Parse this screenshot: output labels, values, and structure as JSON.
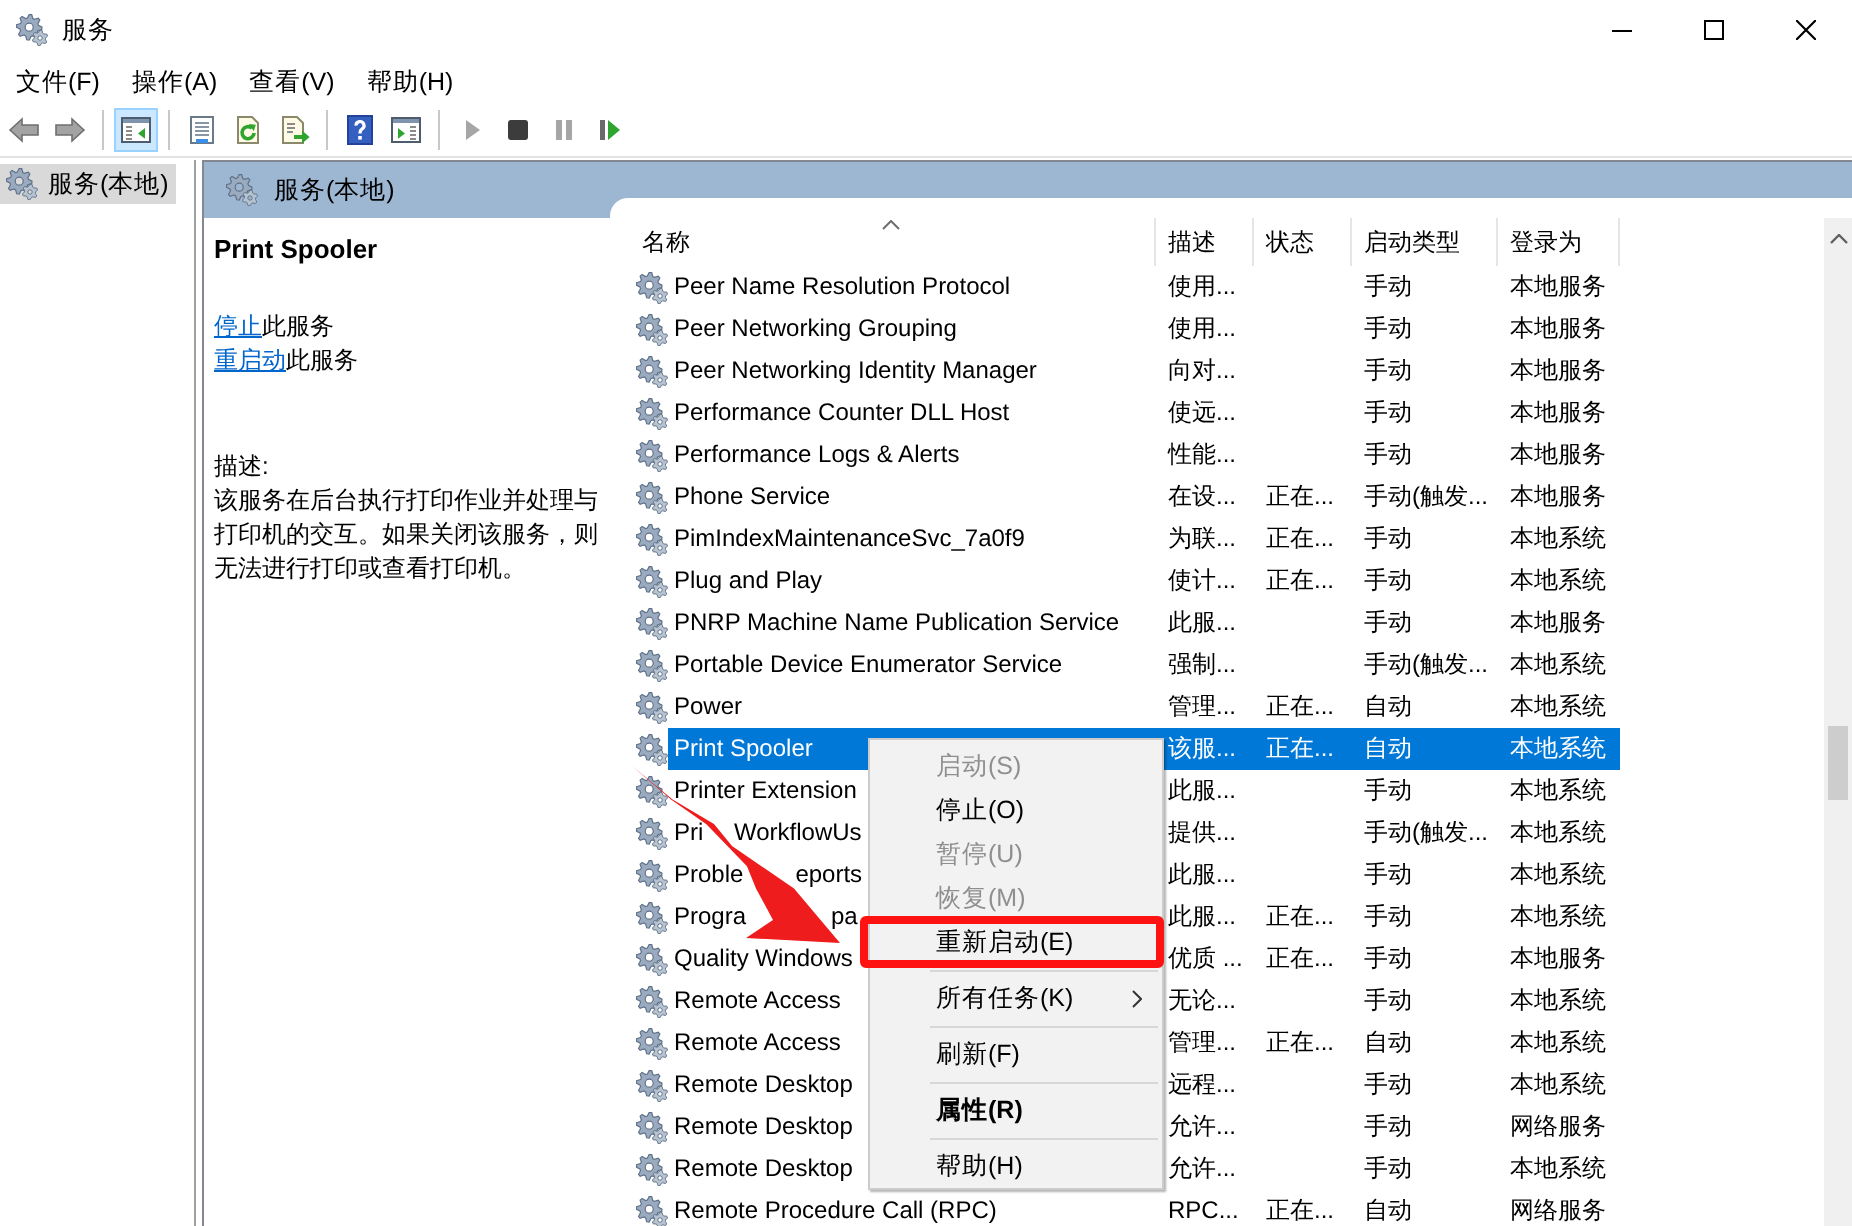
{
  "window": {
    "title": "服务"
  },
  "menu_bar": [
    "文件(F)",
    "操作(A)",
    "查看(V)",
    "帮助(H)"
  ],
  "toolbar": [
    [
      {
        "kind": "back",
        "on": false,
        "disabled": false
      },
      {
        "kind": "forward",
        "on": false,
        "disabled": false
      }
    ],
    [
      {
        "kind": "console-tree",
        "on": true,
        "disabled": false
      }
    ],
    [
      {
        "kind": "properties",
        "on": false,
        "disabled": false
      },
      {
        "kind": "refresh",
        "on": false,
        "disabled": false
      },
      {
        "kind": "export",
        "on": false,
        "disabled": false
      }
    ],
    [
      {
        "kind": "help",
        "on": false,
        "disabled": false
      },
      {
        "kind": "action-pane",
        "on": false,
        "disabled": false
      }
    ],
    [
      {
        "kind": "start",
        "on": false,
        "disabled": true
      },
      {
        "kind": "stop",
        "on": false,
        "disabled": false
      },
      {
        "kind": "pause",
        "on": false,
        "disabled": true
      },
      {
        "kind": "restart",
        "on": false,
        "disabled": false
      }
    ]
  ],
  "tree": {
    "items": [
      {
        "label": "服务(本地)",
        "selected": true
      }
    ]
  },
  "panel": {
    "title": "服务(本地)"
  },
  "details": {
    "service_name": "Print Spooler",
    "actions": [
      {
        "link": "停止",
        "text": "此服务"
      },
      {
        "link": "重启动",
        "text": "此服务"
      }
    ],
    "description_label": "描述:",
    "description": "该服务在后台执行打印作业并处理与打印机的交互。如果关闭该服务，则无法进行打印或查看打印机。"
  },
  "table": {
    "columns": [
      {
        "label": "名称",
        "sorted": true
      },
      {
        "label": "描述",
        "sorted": false
      },
      {
        "label": "状态",
        "sorted": false
      },
      {
        "label": "启动类型",
        "sorted": false
      },
      {
        "label": "登录为",
        "sorted": false
      }
    ],
    "rows": [
      {
        "name": "Peer Name Resolution Protocol",
        "description": "使用...",
        "startup_type": "手动",
        "log_on_as": "本地服务",
        "selected": false
      },
      {
        "name": "Peer Networking Grouping",
        "description": "使用...",
        "startup_type": "手动",
        "log_on_as": "本地服务",
        "selected": false
      },
      {
        "name": "Peer Networking Identity Manager",
        "description": "向对...",
        "startup_type": "手动",
        "log_on_as": "本地服务",
        "selected": false
      },
      {
        "name": "Performance Counter DLL Host",
        "description": "使远...",
        "startup_type": "手动",
        "log_on_as": "本地服务",
        "selected": false
      },
      {
        "name": "Performance Logs & Alerts",
        "description": "性能...",
        "startup_type": "手动",
        "log_on_as": "本地服务",
        "selected": false
      },
      {
        "name": "Phone Service",
        "description": "在设...",
        "status": "正在...",
        "startup_type": "手动(触发...",
        "log_on_as": "本地服务",
        "selected": false
      },
      {
        "name": "PimIndexMaintenanceSvc_7a0f9",
        "description": "为联...",
        "status": "正在...",
        "startup_type": "手动",
        "log_on_as": "本地系统",
        "selected": false
      },
      {
        "name": "Plug and Play",
        "description": "使计...",
        "status": "正在...",
        "startup_type": "手动",
        "log_on_as": "本地系统",
        "selected": false
      },
      {
        "name": "PNRP Machine Name Publication Service",
        "description": "此服...",
        "startup_type": "手动",
        "log_on_as": "本地服务",
        "selected": false
      },
      {
        "name": "Portable Device Enumerator Service",
        "description": "强制...",
        "startup_type": "手动(触发...",
        "log_on_as": "本地系统",
        "selected": false
      },
      {
        "name": "Power",
        "description": "管理...",
        "status": "正在...",
        "startup_type": "自动",
        "log_on_as": "本地系统",
        "selected": false
      },
      {
        "name": "Print Spooler",
        "description": "该服...",
        "status": "正在...",
        "startup_type": "自动",
        "log_on_as": "本地系统",
        "selected": true
      },
      {
        "name": "Printer Extension",
        "description": "此服...",
        "startup_type": "手动",
        "log_on_as": "本地系统",
        "selected": false
      },
      {
        "name": "Pri",
        "name_end": "WorkflowUs",
        "description": "提供...",
        "startup_type": "手动(触发...",
        "log_on_as": "本地系统",
        "selected": false
      },
      {
        "name": "Proble",
        "name_end": "eports",
        "description": "此服...",
        "startup_type": "手动",
        "log_on_as": "本地系统",
        "selected": false
      },
      {
        "name": "Progra",
        "name_end": "pa",
        "description": "此服...",
        "status": "正在...",
        "startup_type": "手动",
        "log_on_as": "本地系统",
        "selected": false
      },
      {
        "name": "Quality Windows",
        "description": "优质 ...",
        "status": "正在...",
        "startup_type": "手动",
        "log_on_as": "本地服务",
        "selected": false
      },
      {
        "name": "Remote Access",
        "description": "无论...",
        "startup_type": "手动",
        "log_on_as": "本地系统",
        "selected": false
      },
      {
        "name": "Remote Access",
        "description": "管理...",
        "status": "正在...",
        "startup_type": "自动",
        "log_on_as": "本地系统",
        "selected": false
      },
      {
        "name": "Remote Desktop",
        "description": "远程...",
        "startup_type": "手动",
        "log_on_as": "本地系统",
        "selected": false
      },
      {
        "name": "Remote Desktop",
        "description": "允许...",
        "startup_type": "手动",
        "log_on_as": "网络服务",
        "selected": false
      },
      {
        "name": "Remote Desktop",
        "description": "允许...",
        "startup_type": "手动",
        "log_on_as": "本地系统",
        "selected": false
      },
      {
        "name": "Remote Procedure Call (RPC)",
        "description": "RPC...",
        "status": "正在...",
        "startup_type": "自动",
        "log_on_as": "网络服务",
        "selected": false
      }
    ]
  },
  "context_menu": {
    "groups": [
      {
        "items": [
          {
            "label": "启动(S)",
            "disabled": true,
            "default": false,
            "submenu": false,
            "highlighted": false
          },
          {
            "label": "停止(O)",
            "disabled": false,
            "default": false,
            "submenu": false,
            "highlighted": false
          },
          {
            "label": "暂停(U)",
            "disabled": true,
            "default": false,
            "submenu": false,
            "highlighted": false
          },
          {
            "label": "恢复(M)",
            "disabled": true,
            "default": false,
            "submenu": false,
            "highlighted": false
          },
          {
            "label": "重新启动(E)",
            "disabled": false,
            "default": false,
            "submenu": false,
            "highlighted": true
          }
        ]
      },
      {
        "items": [
          {
            "label": "所有任务(K)",
            "disabled": false,
            "default": false,
            "submenu": true,
            "highlighted": false
          }
        ]
      },
      {
        "items": [
          {
            "label": "刷新(F)",
            "disabled": false,
            "default": false,
            "submenu": false,
            "highlighted": false
          }
        ]
      },
      {
        "items": [
          {
            "label": "属性(R)",
            "disabled": false,
            "default": true,
            "submenu": false,
            "highlighted": false
          }
        ]
      },
      {
        "items": [
          {
            "label": "帮助(H)",
            "disabled": false,
            "default": false,
            "submenu": false,
            "highlighted": false
          }
        ]
      }
    ]
  }
}
